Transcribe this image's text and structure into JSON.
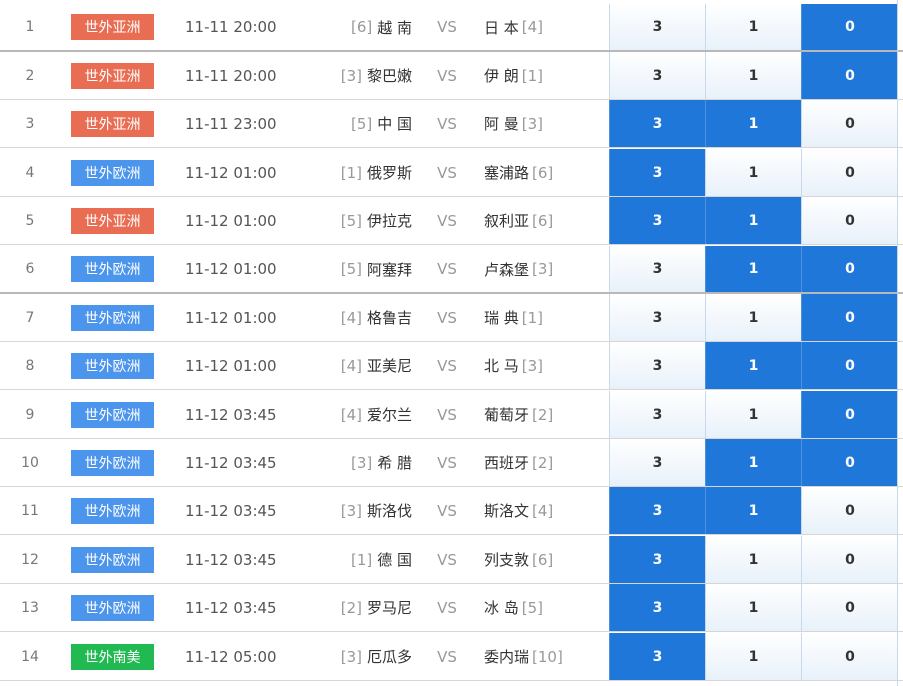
{
  "vs_label": "VS",
  "colors": {
    "asia_badge": "#e96d52",
    "europe_badge": "#4c95ec",
    "south_america_badge": "#21ba52",
    "selected_odd": "#1f78d9"
  },
  "matches": [
    {
      "num": "1",
      "league": "世外亚洲",
      "league_type": "asia",
      "time": "11-11 20:00",
      "home_rank": "[6]",
      "home": "越 南",
      "away": "日 本",
      "away_rank": "[4]",
      "odds": [
        "3",
        "1",
        "0"
      ],
      "selected": [
        false,
        false,
        true
      ]
    },
    {
      "num": "2",
      "league": "世外亚洲",
      "league_type": "asia",
      "time": "11-11 20:00",
      "home_rank": "[3]",
      "home": "黎巴嫩",
      "away": "伊 朗",
      "away_rank": "[1]",
      "odds": [
        "3",
        "1",
        "0"
      ],
      "selected": [
        false,
        false,
        true
      ]
    },
    {
      "num": "3",
      "league": "世外亚洲",
      "league_type": "asia",
      "time": "11-11 23:00",
      "home_rank": "[5]",
      "home": "中 国",
      "away": "阿 曼",
      "away_rank": "[3]",
      "odds": [
        "3",
        "1",
        "0"
      ],
      "selected": [
        true,
        true,
        false
      ]
    },
    {
      "num": "4",
      "league": "世外欧洲",
      "league_type": "europe",
      "time": "11-12 01:00",
      "home_rank": "[1]",
      "home": "俄罗斯",
      "away": "塞浦路",
      "away_rank": "[6]",
      "odds": [
        "3",
        "1",
        "0"
      ],
      "selected": [
        true,
        false,
        false
      ]
    },
    {
      "num": "5",
      "league": "世外亚洲",
      "league_type": "asia",
      "time": "11-12 01:00",
      "home_rank": "[5]",
      "home": "伊拉克",
      "away": "叙利亚",
      "away_rank": "[6]",
      "odds": [
        "3",
        "1",
        "0"
      ],
      "selected": [
        true,
        true,
        false
      ]
    },
    {
      "num": "6",
      "league": "世外欧洲",
      "league_type": "europe",
      "time": "11-12 01:00",
      "home_rank": "[5]",
      "home": "阿塞拜",
      "away": "卢森堡",
      "away_rank": "[3]",
      "odds": [
        "3",
        "1",
        "0"
      ],
      "selected": [
        false,
        true,
        true
      ]
    },
    {
      "num": "7",
      "league": "世外欧洲",
      "league_type": "europe",
      "time": "11-12 01:00",
      "home_rank": "[4]",
      "home": "格鲁吉",
      "away": "瑞 典",
      "away_rank": "[1]",
      "odds": [
        "3",
        "1",
        "0"
      ],
      "selected": [
        false,
        false,
        true
      ]
    },
    {
      "num": "8",
      "league": "世外欧洲",
      "league_type": "europe",
      "time": "11-12 01:00",
      "home_rank": "[4]",
      "home": "亚美尼",
      "away": "北 马",
      "away_rank": "[3]",
      "odds": [
        "3",
        "1",
        "0"
      ],
      "selected": [
        false,
        true,
        true
      ]
    },
    {
      "num": "9",
      "league": "世外欧洲",
      "league_type": "europe",
      "time": "11-12 03:45",
      "home_rank": "[4]",
      "home": "爱尔兰",
      "away": "葡萄牙",
      "away_rank": "[2]",
      "odds": [
        "3",
        "1",
        "0"
      ],
      "selected": [
        false,
        false,
        true
      ]
    },
    {
      "num": "10",
      "league": "世外欧洲",
      "league_type": "europe",
      "time": "11-12 03:45",
      "home_rank": "[3]",
      "home": "希 腊",
      "away": "西班牙",
      "away_rank": "[2]",
      "odds": [
        "3",
        "1",
        "0"
      ],
      "selected": [
        false,
        true,
        true
      ]
    },
    {
      "num": "11",
      "league": "世外欧洲",
      "league_type": "europe",
      "time": "11-12 03:45",
      "home_rank": "[3]",
      "home": "斯洛伐",
      "away": "斯洛文",
      "away_rank": "[4]",
      "odds": [
        "3",
        "1",
        "0"
      ],
      "selected": [
        true,
        true,
        false
      ]
    },
    {
      "num": "12",
      "league": "世外欧洲",
      "league_type": "europe",
      "time": "11-12 03:45",
      "home_rank": "[1]",
      "home": "德 国",
      "away": "列支敦",
      "away_rank": "[6]",
      "odds": [
        "3",
        "1",
        "0"
      ],
      "selected": [
        true,
        false,
        false
      ]
    },
    {
      "num": "13",
      "league": "世外欧洲",
      "league_type": "europe",
      "time": "11-12 03:45",
      "home_rank": "[2]",
      "home": "罗马尼",
      "away": "冰 岛",
      "away_rank": "[5]",
      "odds": [
        "3",
        "1",
        "0"
      ],
      "selected": [
        true,
        false,
        false
      ]
    },
    {
      "num": "14",
      "league": "世外南美",
      "league_type": "south",
      "time": "11-12 05:00",
      "home_rank": "[3]",
      "home": "厄瓜多",
      "away": "委内瑞",
      "away_rank": "[10]",
      "odds": [
        "3",
        "1",
        "0"
      ],
      "selected": [
        true,
        false,
        false
      ]
    }
  ]
}
